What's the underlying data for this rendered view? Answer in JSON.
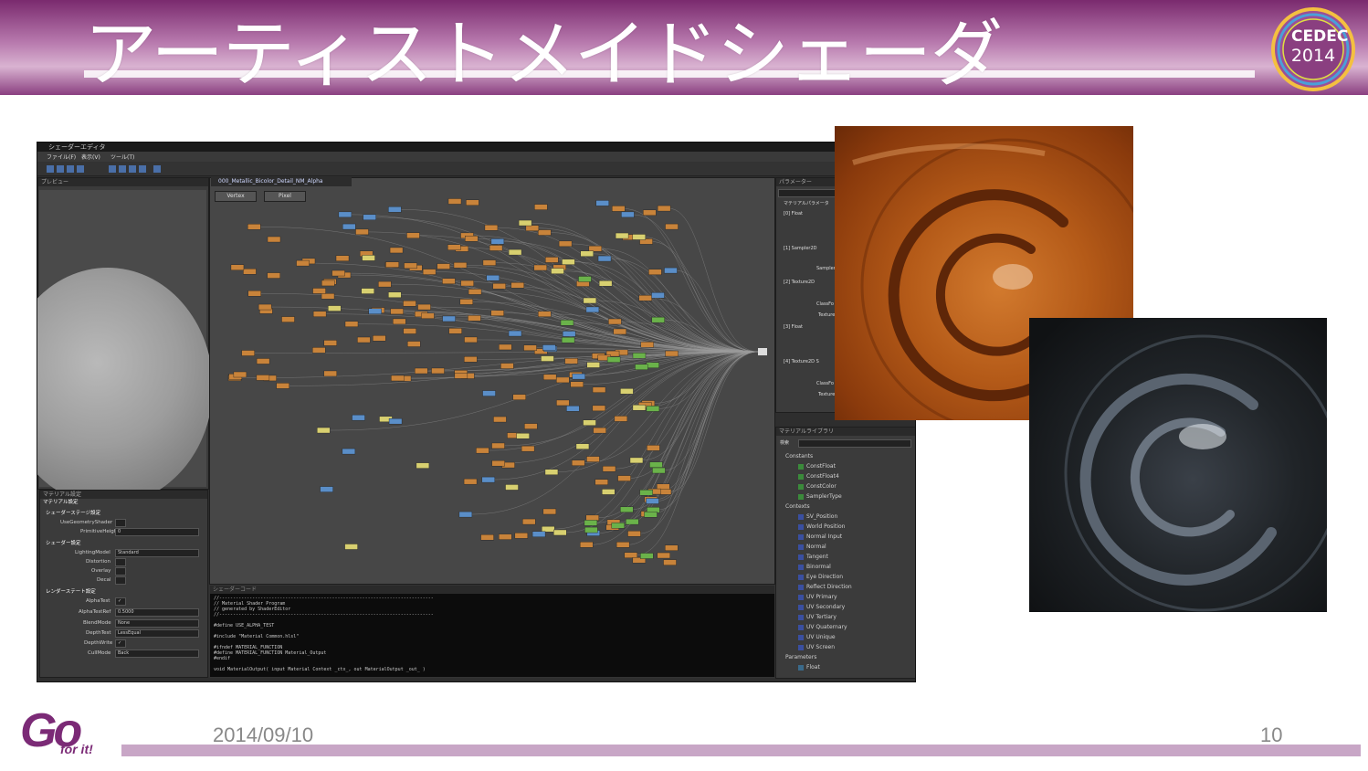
{
  "slide": {
    "title": "アーティストメイドシェーダ",
    "date": "2014/09/10",
    "page_number": "10",
    "conference_logo": {
      "line1": "CEDEC",
      "line2": "2014"
    },
    "brand_logo": {
      "main": "Go",
      "sub": "for it!"
    }
  },
  "editor": {
    "window_title": "シェーダーエディタ",
    "menus": [
      "ファイル(F)",
      "表示(V)",
      "ツール(T)"
    ],
    "graph_tab_title": "000_Metallic_Bicolor_Detail_NM_Alpha",
    "stage_buttons": [
      "Vertex",
      "Pixel"
    ],
    "preview_panel_title": "プレビュー",
    "param_panel_title": "パラメーター",
    "param_items": [
      "マテリアルパラメータ",
      "[0] Float",
      "[1] Sampler2D",
      "[2] Texture2D",
      "[3] Float",
      "[4] Texture2D S"
    ],
    "param_sublabels": [
      "Sampler",
      "ClassFo",
      "Texture",
      "ClassFo",
      "Texture"
    ],
    "library_title": "マテリアルライブラリ",
    "library_search_label": "検索",
    "library_groups": [
      {
        "name": "Constants",
        "items": [
          "ConstFloat",
          "ConstFloat4",
          "ConstColor",
          "SamplerType"
        ]
      },
      {
        "name": "Contexts",
        "items": [
          "SV_Position",
          "World Position",
          "Normal Input",
          "Normal",
          "Tangent",
          "Binormal",
          "Eye Direction",
          "Reflect Direction",
          "UV Primary",
          "UV Secondary",
          "UV Tertiary",
          "UV Quaternary",
          "UV Unique",
          "UV Screen"
        ]
      },
      {
        "name": "Parameters",
        "items": [
          "Float"
        ]
      }
    ],
    "matset_panel_title": "マテリアル設定",
    "matset_subtitle": "マテリアル設定",
    "matset_sections": [
      {
        "header": "シェーダーステージ設定",
        "rows": [
          {
            "label": "UseGeometryShader",
            "value": ""
          },
          {
            "label": "PrimitiveHeight",
            "value": "0"
          }
        ]
      },
      {
        "header": "シェーダー設定",
        "rows": [
          {
            "label": "LightingModel",
            "value": "Standard"
          },
          {
            "label": "Distortion",
            "value": ""
          },
          {
            "label": "Overlay",
            "value": ""
          },
          {
            "label": "Decal",
            "value": ""
          }
        ]
      },
      {
        "header": "レンダーステート設定",
        "rows": [
          {
            "label": "AlphaTest",
            "value": "✓"
          },
          {
            "label": "AlphaTestRef",
            "value": "0.5000"
          },
          {
            "label": "BlendMode",
            "value": "None"
          },
          {
            "label": "DepthTest",
            "value": "LessEqual"
          },
          {
            "label": "DepthWrite",
            "value": "✓"
          },
          {
            "label": "CullMode",
            "value": "Back"
          }
        ]
      }
    ],
    "code_panel_title": "シェーダーコード",
    "code_lines": [
      "//------------------------------------------------------------------------------",
      "// Material Shader Program",
      "// generated by ShaderEditor",
      "//------------------------------------------------------------------------------",
      "",
      "#define USE_ALPHA_TEST",
      "",
      "#include \"Material Common.hlsl\"",
      "",
      "#ifndef MATERIAL_FUNCTION",
      "#define MATERIAL_FUNCTION Material_Output",
      "#endif",
      "",
      "void MaterialOutput( input Material Context _ctx_, out MaterialOutput _out_ )"
    ]
  },
  "colors": {
    "title_bar": "#8a3f80",
    "footer_line": "#c8a6c6",
    "logo": "#7b2a76"
  }
}
